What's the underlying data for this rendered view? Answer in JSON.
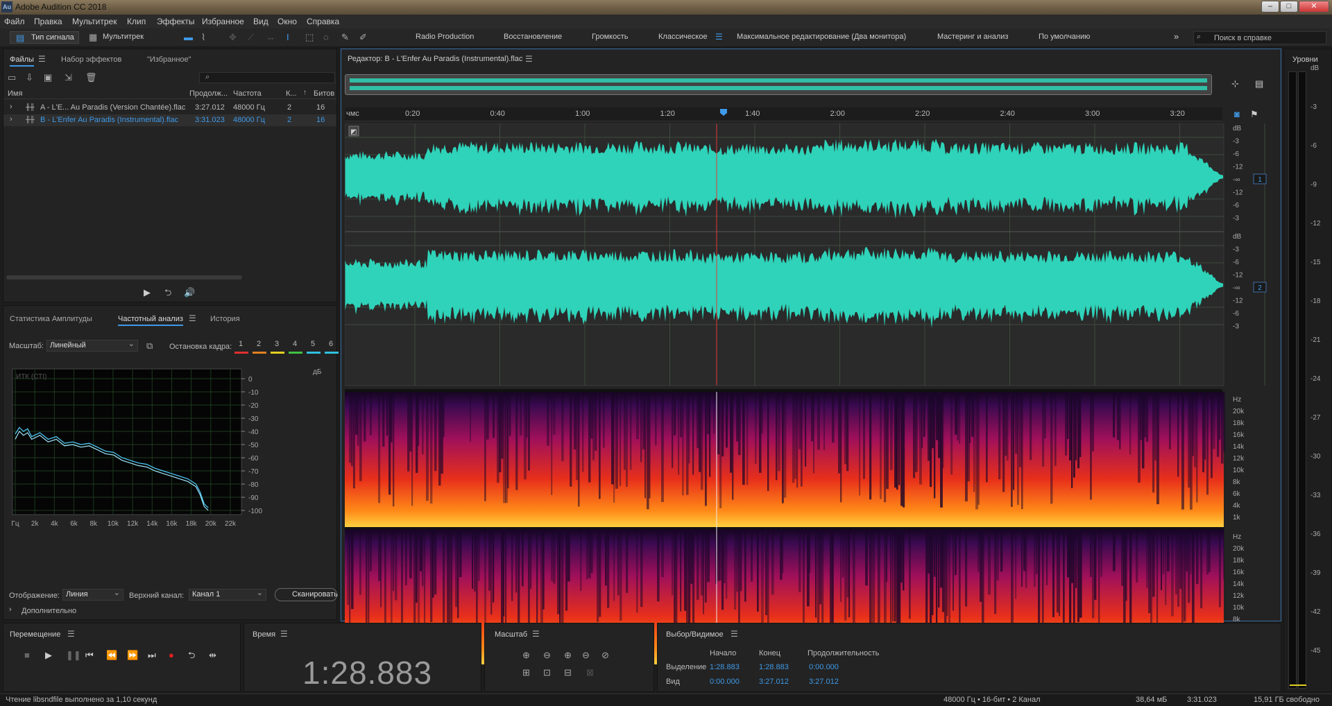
{
  "window": {
    "title": "Adobe Audition CC 2018",
    "app_icon": "Au"
  },
  "menu": [
    "Файл",
    "Правка",
    "Мультитрек",
    "Клип",
    "Эффекты",
    "Избранное",
    "Вид",
    "Окно",
    "Справка"
  ],
  "toolbar": {
    "mode_waveform": "Тип сигнала",
    "mode_multitrack": "Мультитрек",
    "workspaces": [
      "Radio Production",
      "Восстановление",
      "Громкость",
      "Классическое",
      "Максимальное редактирование (Два монитора)",
      "Мастеринг и анализ",
      "По умолчанию"
    ],
    "active_workspace": "Классическое",
    "search_placeholder": "Поиск в справке"
  },
  "files_panel": {
    "tabs": [
      "Файлы",
      "Набор эффектов",
      "\"Избранное\""
    ],
    "columns": [
      "Имя",
      "Продолж...",
      "Частота",
      "К...",
      "Битов"
    ],
    "rows": [
      {
        "name": "A - L'E... Au Paradis (Version Chantée).flac",
        "duration": "3:27.012",
        "rate": "48000 Гц",
        "ch": "2",
        "bits": "16"
      },
      {
        "name": "B - L'Enfer Au Paradis (Instrumental).flac",
        "duration": "3:31.023",
        "rate": "48000 Гц",
        "ch": "2",
        "bits": "16"
      }
    ]
  },
  "analysis_panel": {
    "tabs": [
      "Статистика Амплитуды",
      "Частотный анализ",
      "История"
    ],
    "scale_label": "Масштаб:",
    "scale_value": "Линейный",
    "freeze_label": "Остановка кадра:",
    "freeze_slots": [
      "1",
      "2",
      "3",
      "4",
      "5",
      "6"
    ],
    "freeze_colors": [
      "#e03030",
      "#e08020",
      "#e0d020",
      "#40c040",
      "#30c0e0",
      "#30c0e0"
    ],
    "chart_corner_label": "ИТК (СТI)",
    "display_label": "Отображение:",
    "display_value": "Линия",
    "channel_label": "Верхний канал:",
    "channel_value": "Канал 1",
    "scan_button": "Сканировать",
    "advanced": "Дополнительно"
  },
  "chart_data": {
    "type": "line",
    "ylabel": "дБ",
    "x_ticks": [
      "Гц",
      "2k",
      "4k",
      "6k",
      "8k",
      "10k",
      "12k",
      "14k",
      "16k",
      "18k",
      "20k",
      "22k"
    ],
    "y_ticks": [
      "0",
      "-10",
      "-20",
      "-30",
      "-40",
      "-50",
      "-60",
      "-70",
      "-80",
      "-90",
      "-100"
    ],
    "ylim": [
      -100,
      0
    ],
    "xlim": [
      0,
      24000
    ],
    "grid": true,
    "series": [
      {
        "x": [
          0,
          500,
          1000,
          1500,
          2000,
          3000,
          4000,
          5000,
          6000,
          7000,
          8000,
          9000,
          10000,
          11000,
          12000,
          13000,
          14000,
          15000,
          16000,
          17000,
          18000,
          19000,
          20000,
          21000,
          22000,
          22500,
          23000,
          23500
        ],
        "y": [
          -42,
          -37,
          -40,
          -38,
          -44,
          -41,
          -46,
          -44,
          -49,
          -48,
          -50,
          -49,
          -52,
          -55,
          -56,
          -60,
          -62,
          -64,
          -65,
          -68,
          -70,
          -72,
          -74,
          -76,
          -80,
          -86,
          -95,
          -98
        ]
      },
      {
        "x": [
          0,
          500,
          1000,
          1500,
          2000,
          3000,
          4000,
          5000,
          6000,
          7000,
          8000,
          9000,
          10000,
          11000,
          12000,
          13000,
          14000,
          15000,
          16000,
          17000,
          18000,
          19000,
          20000,
          21000,
          22000,
          22500,
          23000,
          23500
        ],
        "y": [
          -46,
          -40,
          -43,
          -41,
          -46,
          -43,
          -48,
          -46,
          -51,
          -50,
          -52,
          -51,
          -54,
          -57,
          -58,
          -62,
          -64,
          -66,
          -67,
          -70,
          -72,
          -74,
          -76,
          -78,
          -82,
          -88,
          -97,
          -100
        ]
      }
    ]
  },
  "editor": {
    "title": "Редактор: B - L'Enfer Au Paradis (Instrumental).flac",
    "ruler_label": "чмс",
    "ruler_ticks": [
      "0:20",
      "0:40",
      "1:00",
      "1:20",
      "1:40",
      "2:00",
      "2:20",
      "2:40",
      "3:00",
      "3:20"
    ],
    "db_scale": [
      "dB",
      "-3",
      "-6",
      "-12",
      "-∞",
      "-12",
      "-6",
      "-3"
    ],
    "hz_scale": [
      "Hz",
      "20k",
      "18k",
      "16k",
      "14k",
      "12k",
      "10k",
      "8k",
      "6k",
      "4k",
      "1k"
    ],
    "channel_badges": [
      "1",
      "2"
    ],
    "waveform_color": "#2ed3b9",
    "playhead_color": "#e03a3a"
  },
  "levels_panel": {
    "title": "Уровни",
    "ticks": [
      "dB",
      "-3",
      "-6",
      "-9",
      "-12",
      "-15",
      "-18",
      "-21",
      "-24",
      "-27",
      "-30",
      "-33",
      "-36",
      "-39",
      "-42",
      "-45"
    ]
  },
  "transport": {
    "title": "Перемещение"
  },
  "time_panel": {
    "title": "Время",
    "value": "1:28.883"
  },
  "zoom_panel": {
    "title": "Масштаб"
  },
  "selection_panel": {
    "title": "Выбор/Видимое",
    "headers": [
      "Начало",
      "Конец",
      "Продолжительность"
    ],
    "rows": [
      {
        "label": "Выделение",
        "start": "1:28.883",
        "end": "1:28.883",
        "duration": "0:00.000"
      },
      {
        "label": "Вид",
        "start": "0:00.000",
        "end": "3:27.012",
        "duration": "3:27.012"
      }
    ]
  },
  "status": {
    "left": "Чтение libsndfile выполнено за 1,10 секунд",
    "format": "48000 Гц • 16-бит • 2 Канал",
    "size": "38,64 мБ",
    "duration": "3:31.023",
    "free": "15,91 ГБ свободно"
  }
}
